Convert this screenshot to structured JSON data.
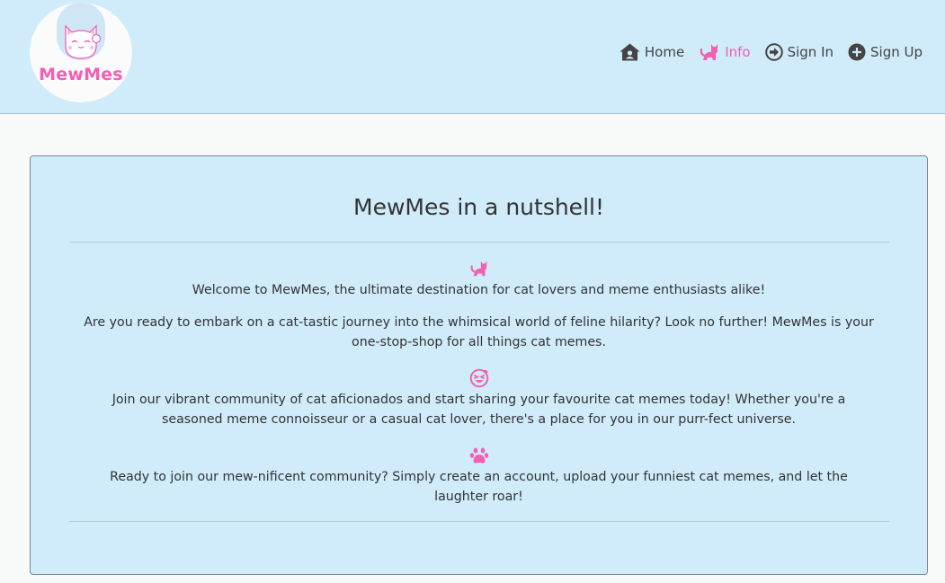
{
  "brand": {
    "name": "MewMes",
    "pink": "#f35fb1",
    "navbar_bg": "#d0ebfa"
  },
  "nav": [
    {
      "label": "Home",
      "icon": "house-user-icon",
      "active": false
    },
    {
      "label": "Info",
      "icon": "cat-icon",
      "active": true
    },
    {
      "label": "Sign In",
      "icon": "circle-arrow-right-icon",
      "active": false
    },
    {
      "label": "Sign Up",
      "icon": "circle-plus-icon",
      "active": false
    }
  ],
  "info": {
    "title": "MewMes in a nutshell!",
    "sections": [
      {
        "icon": "cat-icon",
        "paragraphs": [
          "Welcome to MewMes, the ultimate destination for cat lovers and meme enthusiasts alike!",
          "Are you ready to embark on a cat-tastic journey into the whimsical world of feline hilarity? Look no further! MewMes is your one-stop-shop for all things cat memes."
        ]
      },
      {
        "icon": "laugh-icon",
        "paragraphs": [
          "Join our vibrant community of cat aficionados and start sharing your favourite cat memes today! Whether you're a seasoned meme connoisseur or a casual cat lover, there's a place for you in our purr-fect universe."
        ]
      },
      {
        "icon": "paw-icon",
        "paragraphs": [
          "Ready to join our mew-nificent community? Simply create an account, upload your funniest cat memes, and let the laughter roar!"
        ]
      }
    ]
  }
}
